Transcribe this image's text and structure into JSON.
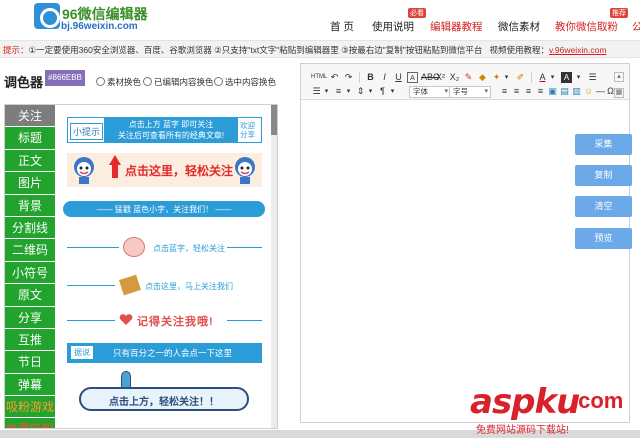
{
  "header": {
    "logo_name": "96微信编辑器",
    "logo_url": "bj.96weixin.com",
    "nav": [
      {
        "label": "首 页",
        "badge": ""
      },
      {
        "label": "使用说明",
        "badge": "必看"
      },
      {
        "label": "编辑器教程",
        "badge": ""
      },
      {
        "label": "微信素材",
        "badge": ""
      },
      {
        "label": "教你微信取粉",
        "badge": "推荐"
      },
      {
        "label": "公",
        "badge": ""
      }
    ]
  },
  "hint": {
    "prefix": "提示：",
    "items": "①一定要使用360安全浏览器、百度、谷歌浏览器 ②只支持\"txt文字\"粘贴到编辑器里 ③按最右边\"复制\"按钮粘贴到微信平台",
    "video_label": "视频使用教程：",
    "video_link": "v.96weixin.com"
  },
  "color_picker": {
    "label": "调色器",
    "value": "#866EBB",
    "options": [
      "素材换色",
      "已编辑内容换色",
      "选中内容换色"
    ]
  },
  "categories": [
    "关注",
    "标题",
    "正文",
    "图片",
    "背景",
    "分割线",
    "二维码",
    "小符号",
    "原文",
    "分享",
    "互推",
    "节日",
    "弹幕",
    "吸粉游戏",
    "免费吸粉"
  ],
  "materials": {
    "m1_tag": "小提示",
    "m1_line1": "点击上方 蓝字 即可关注",
    "m1_line2": "关注后可查看所有的经典文章!",
    "m1_right1": "欢迎",
    "m1_right2": "分享",
    "m2_text": "点击这里，轻松关注",
    "m3_text": "—— 猛戳  蓝色小字，关注我们！ ——",
    "m4_text": "点击蓝字，轻松关注",
    "m5_text": "点击这里，马上关注我们",
    "m6_text": "记得关注我哦!",
    "m7_tag": "据说",
    "m7_text": "只有百分之一的人会点一下这里",
    "m8_text": "点击上方，轻松关注！！"
  },
  "editor": {
    "font_select": "字体",
    "size_select": "字号"
  },
  "actions": [
    "采集",
    "复制",
    "清空",
    "预览"
  ],
  "watermark": {
    "main": "aspku",
    "cn": ".com",
    "sub": "免费网站源码下载站!"
  },
  "colors": {
    "brand_green": "#22a32e",
    "active_gray": "#7d7d7d",
    "accent_blue": "#2c9cd9",
    "action_blue": "#6ba9e8",
    "hint_red": "#d4201f",
    "swatch": "#866EBB"
  }
}
